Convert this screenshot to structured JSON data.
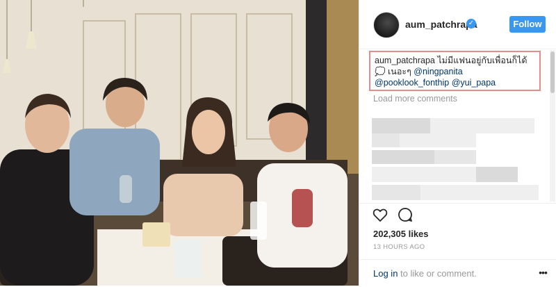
{
  "post": {
    "username": "aum_patchrapa",
    "verified_icon": "verified-badge-icon",
    "follow_label": "Follow",
    "caption": {
      "user": "aum_patchrapa",
      "text": "ไม่มีแฟนอยู่กับเพื่อนก็ได้ 💭 เนอะๆ",
      "mentions": [
        "@ningpanita",
        "@pooklook_fonthip",
        "@yui_papa"
      ]
    },
    "load_more_label": "Load more comments",
    "likes": "202,305 likes",
    "timestamp": "13 HOURS AGO",
    "login": {
      "link_label": "Log in",
      "rest_label": "to like or comment."
    },
    "more_label": "•••"
  },
  "icons": {
    "like": "heart-icon",
    "comment": "comment-icon",
    "more": "more-options-icon"
  },
  "colors": {
    "accent": "#3897f0",
    "highlight_border": "#e88a8a",
    "link": "#003569",
    "muted": "#999999"
  }
}
